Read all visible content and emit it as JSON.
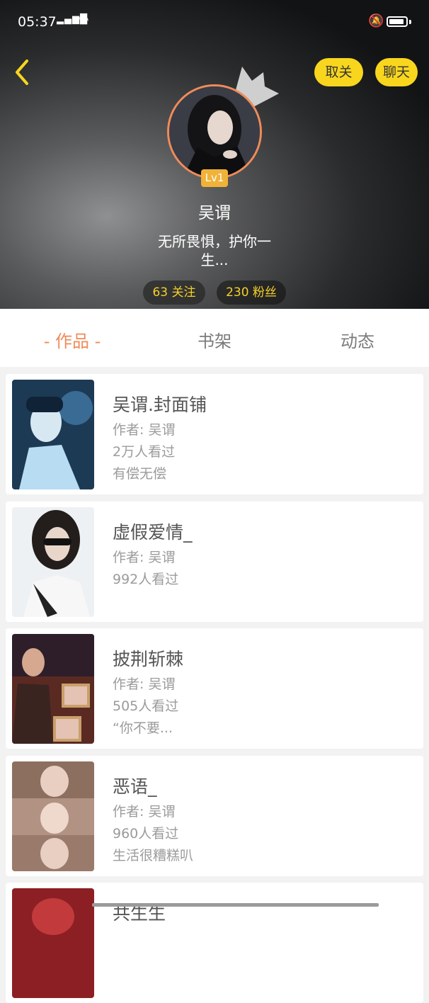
{
  "status_bar": {
    "time": "05:37",
    "signal": "4G"
  },
  "header": {
    "unfollow_label": "取关",
    "chat_label": "聊天",
    "level": "Lv1",
    "username": "吴谓",
    "bio": "无所畏惧，护你一生...",
    "following": "63 关注",
    "fans": "230 粉丝"
  },
  "tabs": [
    "- 作品 -",
    "书架",
    "动态"
  ],
  "books": [
    {
      "title": "吴谓.封面铺",
      "author": "作者: 吴谓",
      "views": "2万人看过",
      "desc": "有偿无偿"
    },
    {
      "title": "虚假爱情_",
      "author": "作者: 吴谓",
      "views": "992人看过",
      "desc": ""
    },
    {
      "title": "披荆斩棘",
      "author": "作者: 吴谓",
      "views": "505人看过",
      "desc": "“你不要..."
    },
    {
      "title": "恶语_",
      "author": "作者: 吴谓",
      "views": "960人看过",
      "desc": "生活很糟糕叭"
    },
    {
      "title": "共生生",
      "author": "",
      "views": "",
      "desc": ""
    }
  ],
  "colors": {
    "accent": "#f08b5a",
    "yellow": "#f8d61e",
    "stat_text": "#f5d029"
  }
}
